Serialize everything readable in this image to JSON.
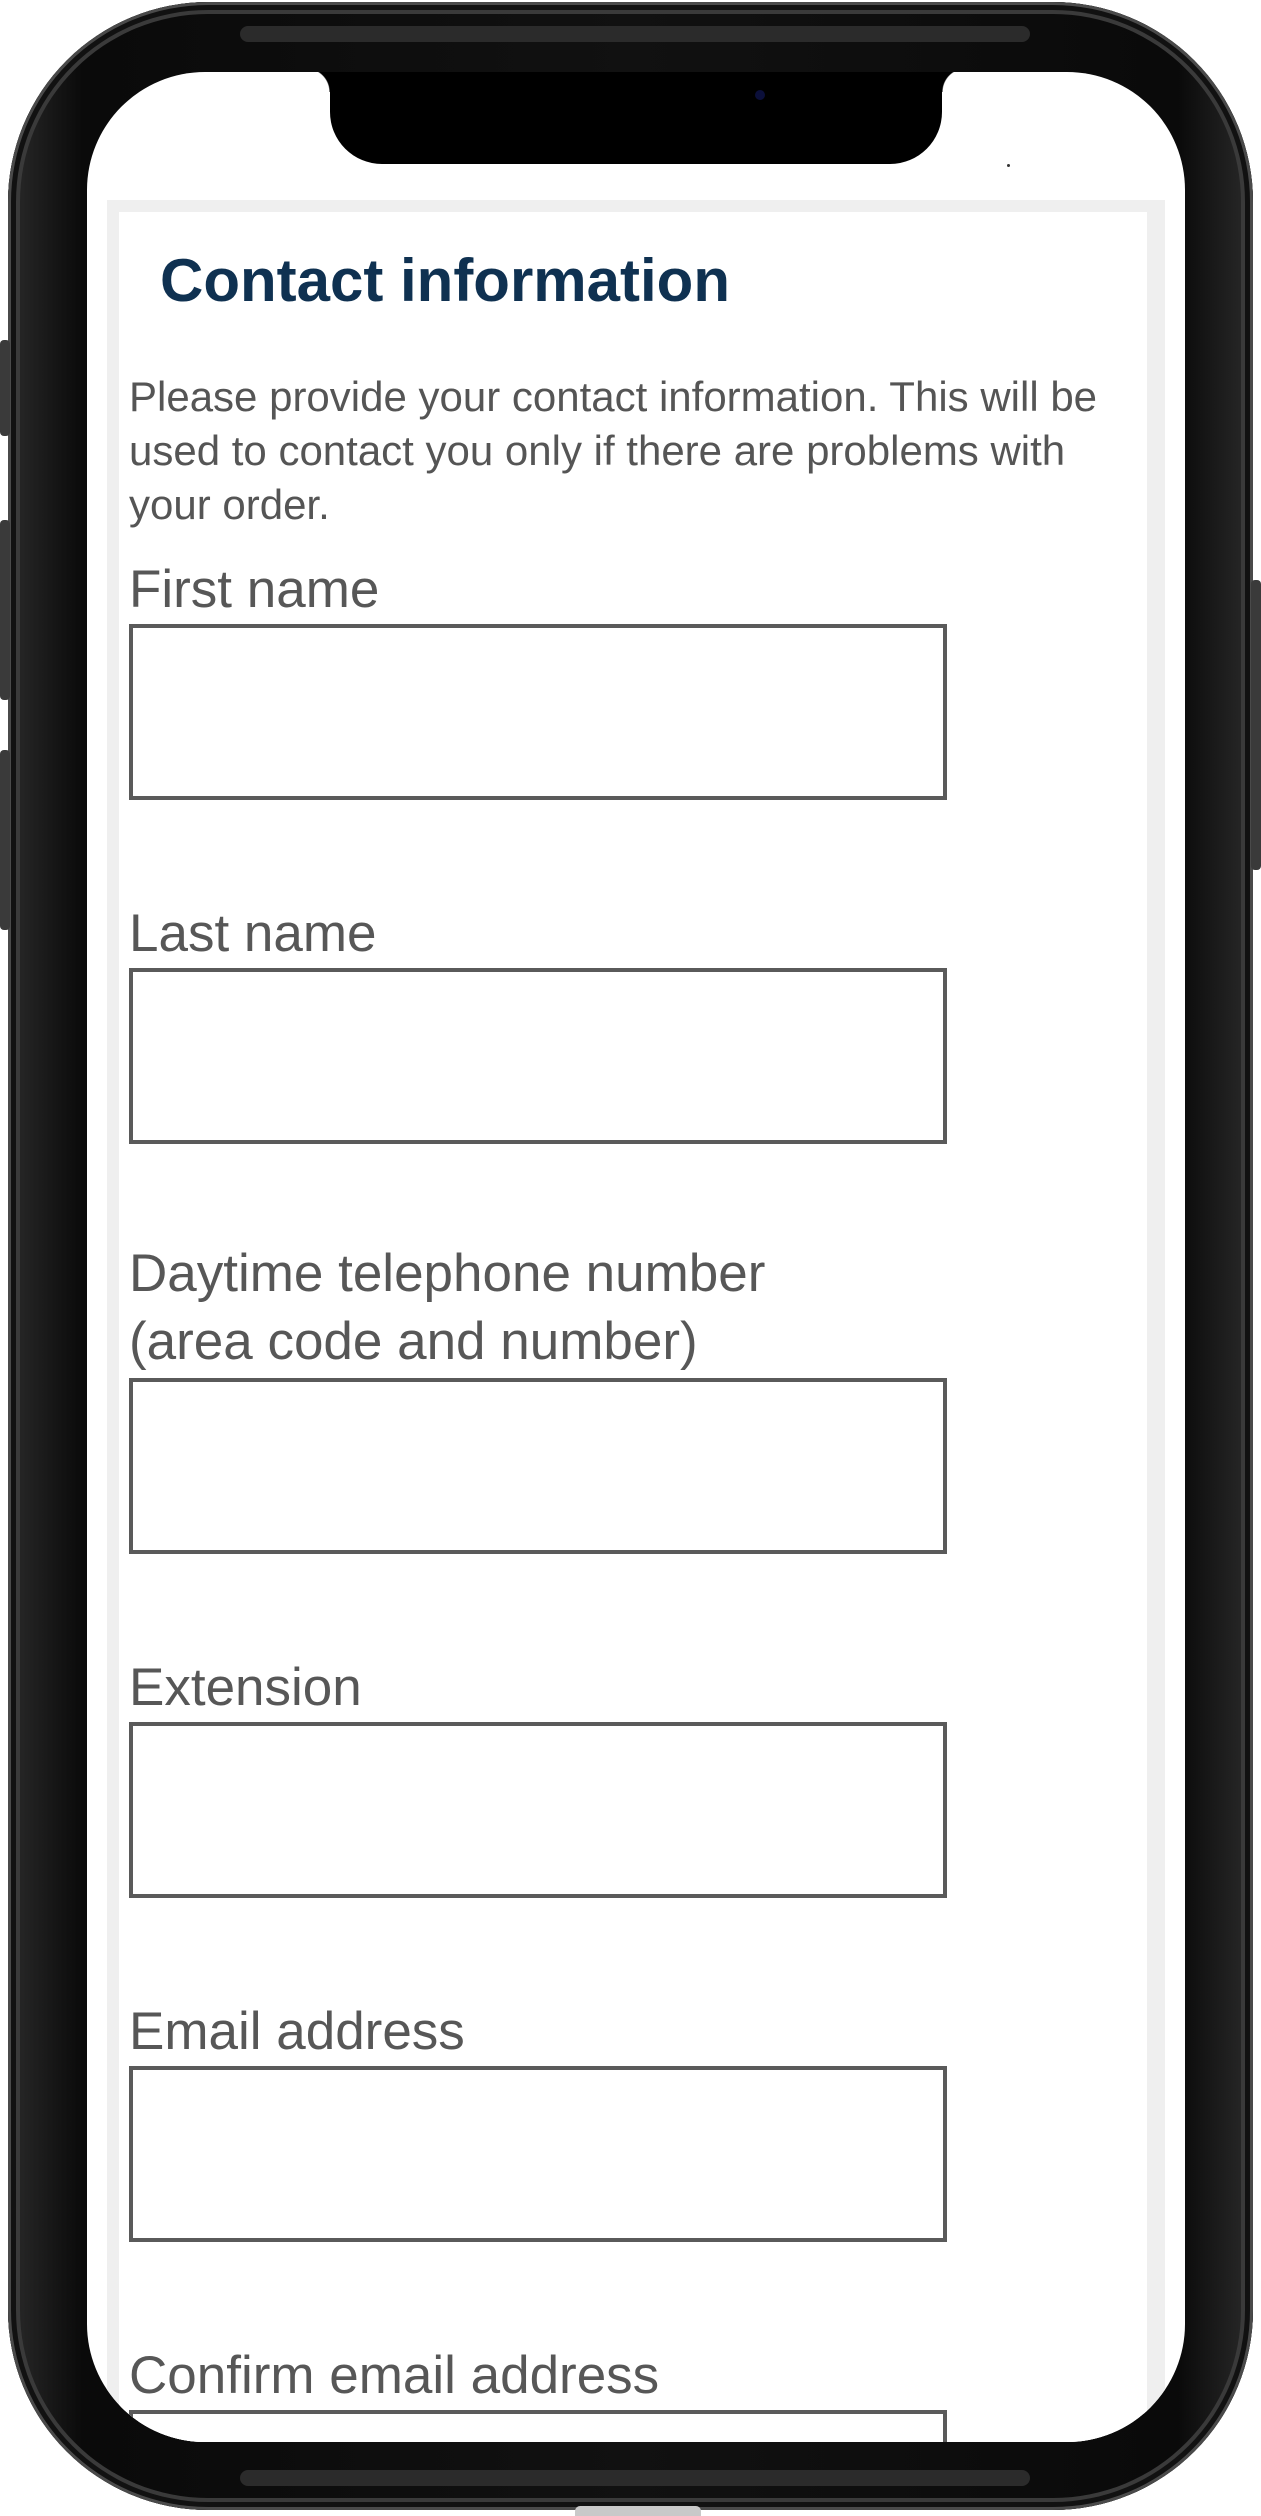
{
  "form": {
    "title": "Contact information",
    "intro": "Please provide your contact information. This will be used to contact you only if there are problems with your order.",
    "fields": [
      {
        "label": "First name",
        "value": ""
      },
      {
        "label": "Last name",
        "value": ""
      },
      {
        "label_line1": "Daytime telephone number",
        "label_line2": "(area code and number)",
        "value": ""
      },
      {
        "label": "Extension",
        "value": ""
      },
      {
        "label": "Email address",
        "value": ""
      },
      {
        "label": "Confirm email address",
        "value": ""
      }
    ]
  },
  "colors": {
    "title": "#0f3151",
    "text": "#555555",
    "input_border": "#5a5a5a",
    "page_frame": "#efefef"
  }
}
